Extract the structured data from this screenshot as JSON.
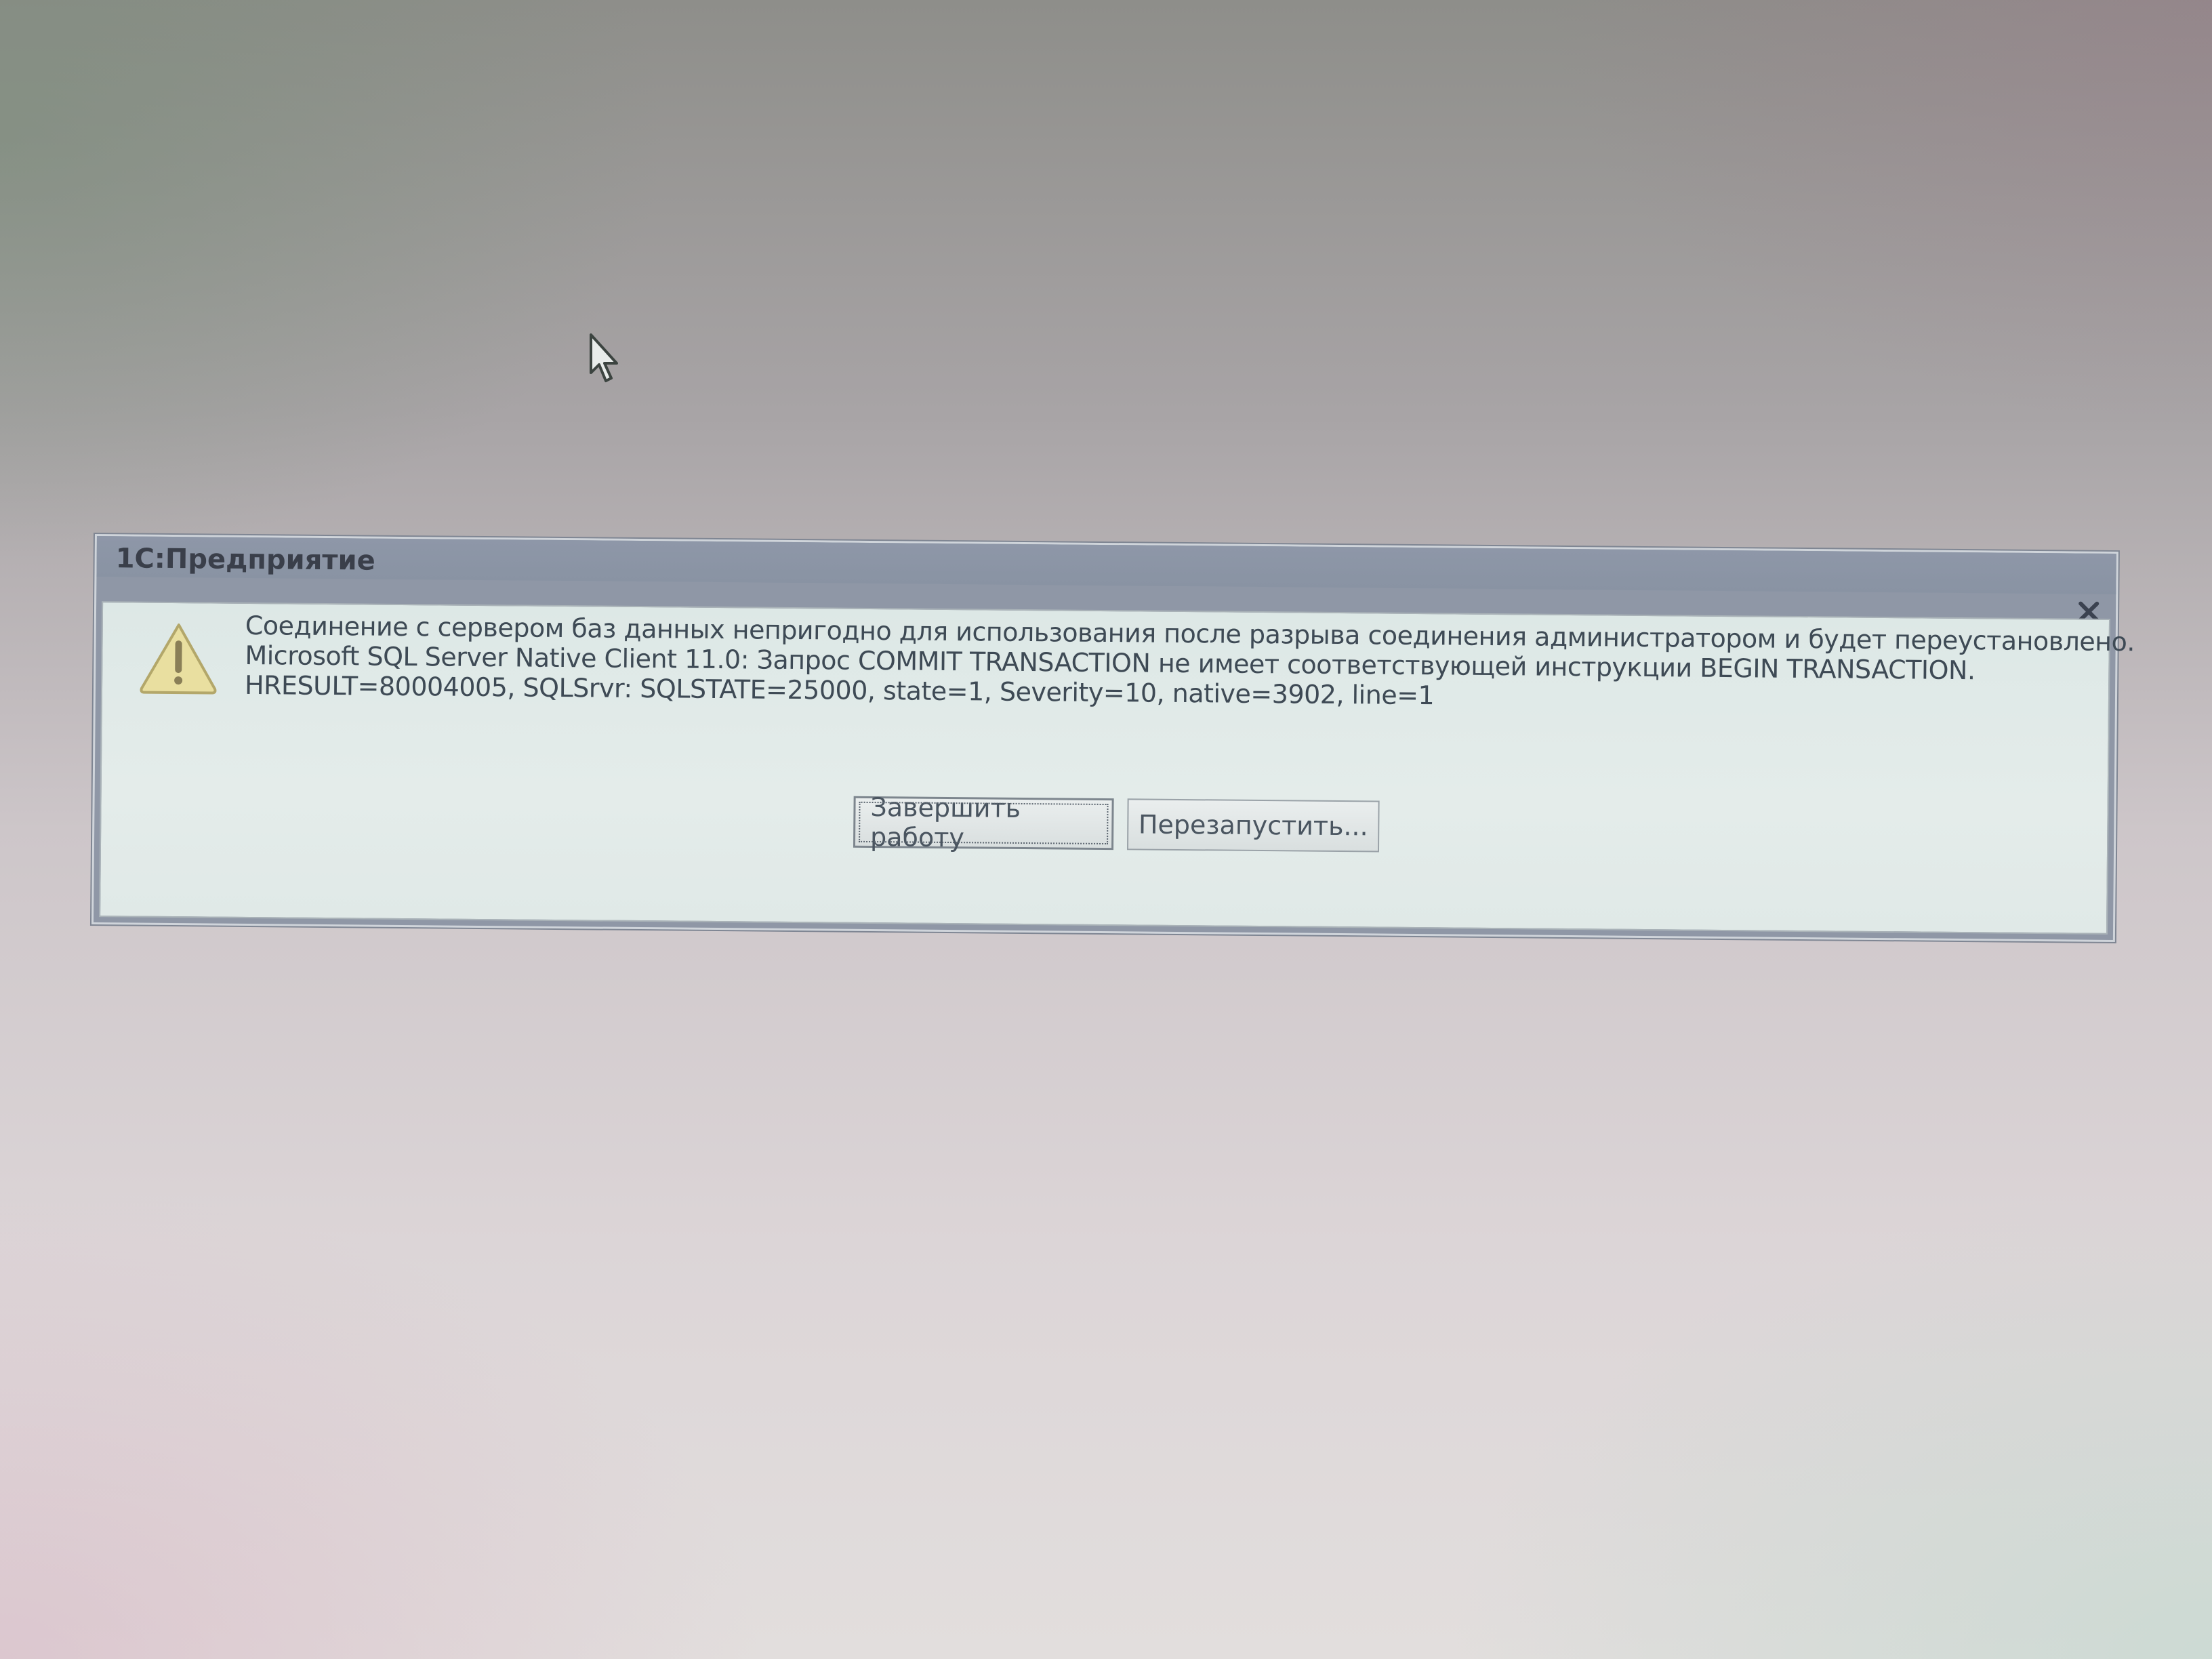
{
  "window": {
    "title": "1С:Предприятие"
  },
  "message": {
    "icon": "warning-triangle-icon",
    "lines": [
      "Соединение с сервером баз данных непригодно для использования после разрыва соединения администратором и будет переустановлено.",
      "Microsoft SQL Server Native Client 11.0: Запрос COMMIT TRANSACTION не имеет соответствующей инструкции BEGIN TRANSACTION.",
      "HRESULT=80004005, SQLSrvr: SQLSTATE=25000, state=1, Severity=10, native=3902, line=1"
    ]
  },
  "buttons": {
    "exit_label": "Завершить работу",
    "restart_label": "Перезапустить..."
  },
  "colors": {
    "titlebar": "#8e97a8",
    "dialog_body": "#dde8e6",
    "text": "#3e4a55",
    "warning_fill": "#e9dfa0"
  }
}
